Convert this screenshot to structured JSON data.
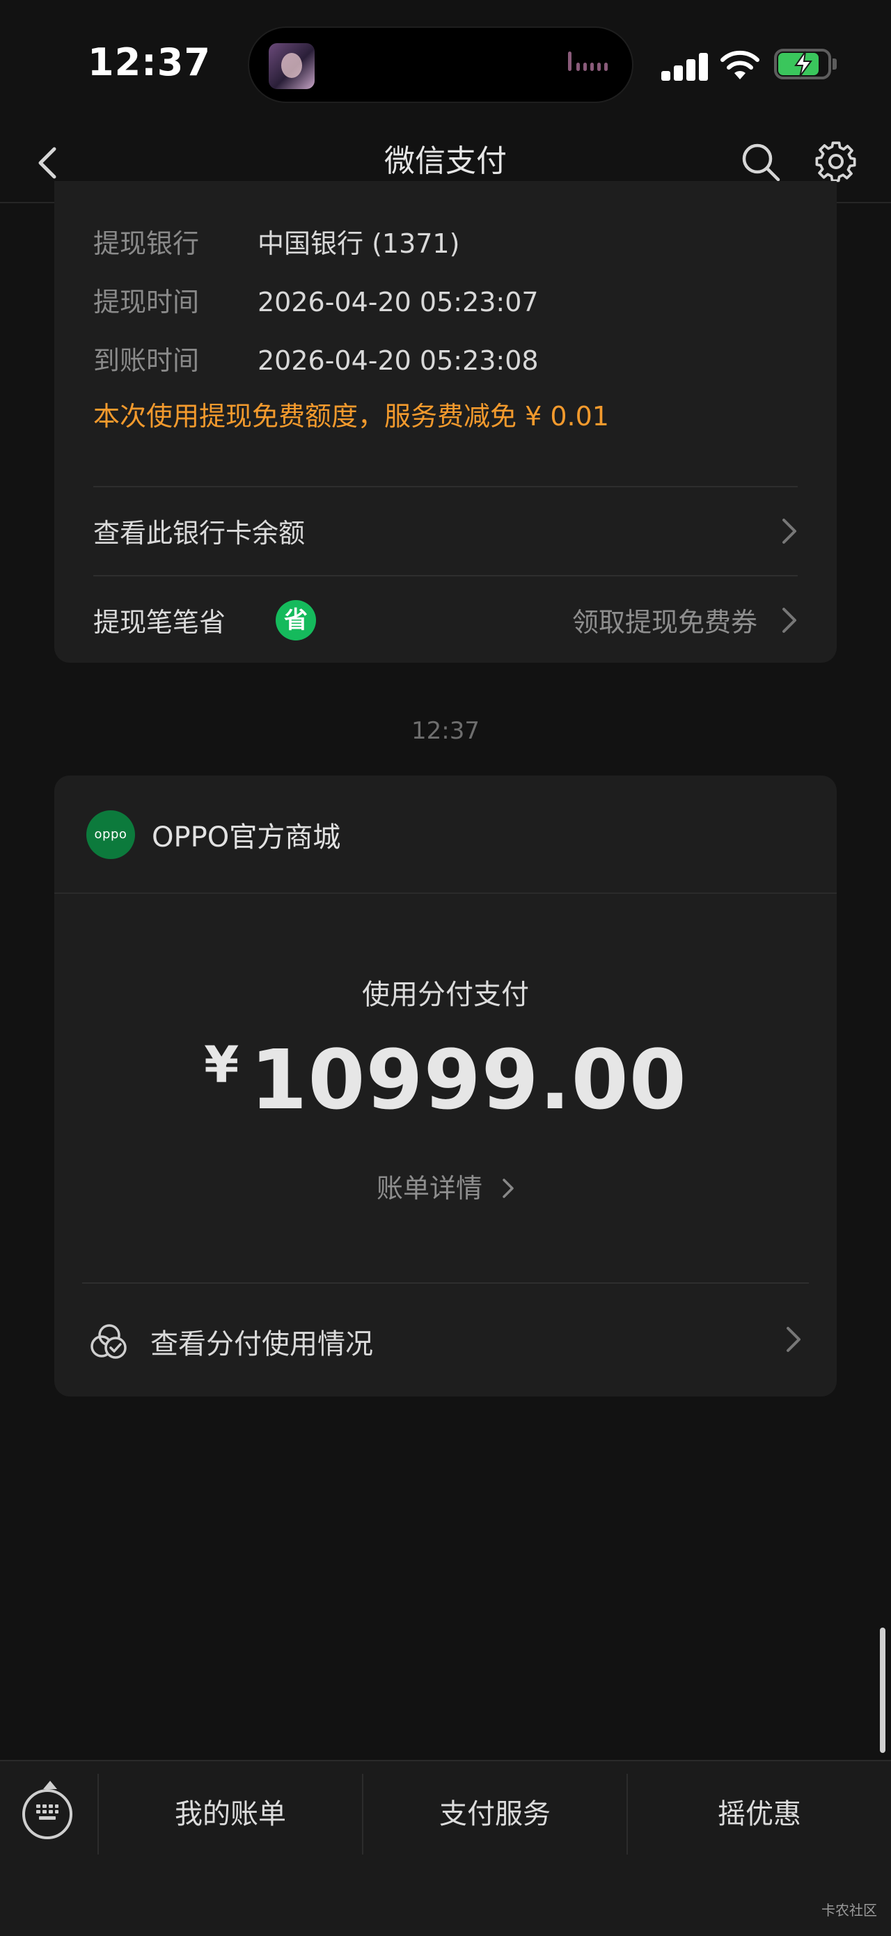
{
  "status_bar": {
    "time": "12:37"
  },
  "nav": {
    "title": "微信支付",
    "icons": [
      "back-chevron-icon",
      "search-icon",
      "gear-icon"
    ]
  },
  "withdraw_card": {
    "rows": [
      {
        "label": "提现银行",
        "value": "中国银行 (1371)"
      },
      {
        "label": "提现时间",
        "value": "2026-04-20 05:23:07"
      },
      {
        "label": "到账时间",
        "value": "2026-04-20 05:23:08"
      }
    ],
    "notice": "本次使用提现免费额度，服务费减免 ¥ 0.01",
    "check_balance": "查看此银行卡余额",
    "saver_label": "提现笔笔省",
    "saver_badge": "省",
    "saver_action": "领取提现免费券"
  },
  "timestamp": "12:37",
  "payment_card": {
    "merchant_logo_text": "oppo",
    "merchant_name": "OPPO官方商城",
    "method": "使用分付支付",
    "currency": "¥",
    "amount": "10999.00",
    "bill_detail": "账单详情",
    "usage_link": "查看分付使用情况"
  },
  "tab_bar": {
    "items": [
      "我的账单",
      "支付服务",
      "摇优惠"
    ]
  },
  "watermark": "卡农社区",
  "colors": {
    "background": "#121212",
    "card": "#1e1e1e",
    "notice_orange": "#f39a2d",
    "save_green": "#15ba5c",
    "merchant_green": "#0c7a3c",
    "battery_green": "#3ac65c"
  }
}
